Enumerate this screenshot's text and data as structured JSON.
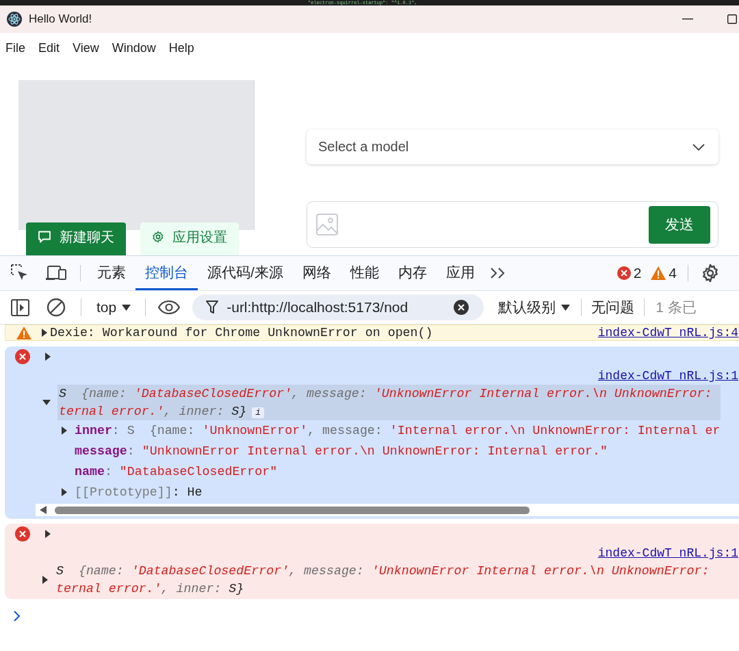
{
  "editor_line": "\"electron-squirrel-startup\": \"^1.0.1\",",
  "window": {
    "title": "Hello World!"
  },
  "menu": [
    "File",
    "Edit",
    "View",
    "Window",
    "Help"
  ],
  "app": {
    "sidebar_buttons": [
      {
        "label": "新建聊天",
        "kind": "primary"
      },
      {
        "label": "应用设置",
        "kind": "secondary"
      }
    ],
    "model_select": {
      "placeholder": "Select a model"
    },
    "composer": {
      "send_button": "发送"
    }
  },
  "devtools": {
    "tabs": [
      {
        "label": "元素",
        "selected": false
      },
      {
        "label": "控制台",
        "selected": true
      },
      {
        "label": "源代码/来源",
        "selected": false
      },
      {
        "label": "网络",
        "selected": false
      },
      {
        "label": "性能",
        "selected": false
      },
      {
        "label": "内存",
        "selected": false
      },
      {
        "label": "应用",
        "selected": false
      }
    ],
    "error_count": "2",
    "warning_count": "4",
    "toolbar": {
      "context": "top",
      "filter": "-url:http://localhost:5173/nod",
      "levels": "默认级别",
      "issues": "无问题",
      "hidden": "1 条已"
    },
    "messages": [
      {
        "kind": "warning",
        "selected": false,
        "expanded": false,
        "text": "Dexie: Workaround for Chrome UnknownError on open()",
        "source": "index-CdwT_nRL.js:4"
      },
      {
        "kind": "error",
        "selected": true,
        "expanded": false,
        "source": "index-CdwT_nRL.js:1",
        "object": {
          "expanded": true,
          "info_badge": "i",
          "lines": [
            [
              {
                "kind": "type",
                "text": "S  "
              },
              {
                "kind": "punct",
                "text": "{name: "
              },
              {
                "kind": "string",
                "text": "'DatabaseClosedError'"
              },
              {
                "kind": "punct",
                "text": ", message: "
              },
              {
                "kind": "string",
                "text": "'UnknownError Internal error.\\n UnknownError: "
              }
            ],
            [
              {
                "kind": "string",
                "text": "ternal error.'"
              },
              {
                "kind": "punct",
                "text": ", inner: "
              },
              {
                "kind": "type",
                "text": "S}"
              }
            ]
          ],
          "properties": [
            {
              "key": "inner",
              "kind": "own",
              "expandable": true,
              "expanded": false,
              "tokens": [
                {
                  "kind": "punct",
                  "text": ": S  {name: "
                },
                {
                  "kind": "string",
                  "text": "'UnknownError'"
                },
                {
                  "kind": "punct",
                  "text": ", message: "
                },
                {
                  "kind": "string",
                  "text": "'Internal error.\\n UnknownError: Internal er"
                }
              ]
            },
            {
              "key": "message",
              "kind": "own",
              "expandable": false,
              "tokens": [
                {
                  "kind": "punct",
                  "text": ": "
                },
                {
                  "kind": "string",
                  "text": "\"UnknownError Internal error.\\n UnknownError: Internal error.\""
                }
              ]
            },
            {
              "key": "name",
              "kind": "own",
              "expandable": false,
              "tokens": [
                {
                  "kind": "punct",
                  "text": ": "
                },
                {
                  "kind": "string",
                  "text": "\"DatabaseClosedError\""
                }
              ]
            },
            {
              "key": "[[Prototype]]",
              "kind": "internal",
              "expandable": true,
              "expanded": false,
              "tokens": [
                {
                  "kind": "type",
                  "text": ": He"
                }
              ]
            }
          ]
        }
      },
      {
        "kind": "error",
        "selected": false,
        "expanded": false,
        "source": "index-CdwT_nRL.js:1",
        "object": {
          "expanded": false,
          "lines": [
            [
              {
                "kind": "type",
                "text": "S  "
              },
              {
                "kind": "punct",
                "text": "{name: "
              },
              {
                "kind": "string",
                "text": "'DatabaseClosedError'"
              },
              {
                "kind": "punct",
                "text": ", message: "
              },
              {
                "kind": "string",
                "text": "'UnknownError Internal error.\\n UnknownError: "
              }
            ],
            [
              {
                "kind": "string",
                "text": "ternal error.'"
              },
              {
                "kind": "punct",
                "text": ", inner: "
              },
              {
                "kind": "type",
                "text": "S}"
              }
            ]
          ]
        }
      }
    ]
  }
}
